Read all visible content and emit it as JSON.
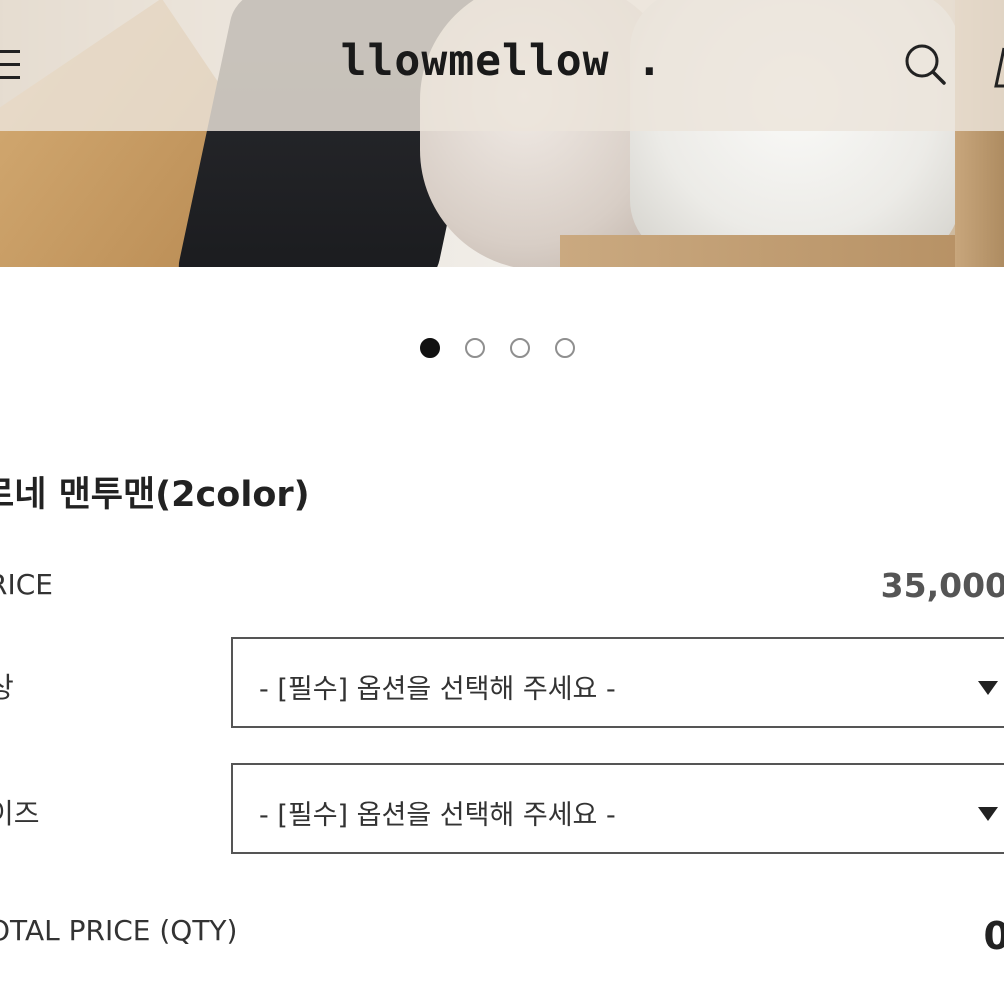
{
  "header": {
    "logo": "llowmellow ."
  },
  "icons": {
    "menu": "menu-icon",
    "search": "search-icon",
    "cart": "cart-icon"
  },
  "carousel": {
    "total_slides": 4,
    "active_index": 0
  },
  "product": {
    "title": "로네 맨투맨(2color)",
    "price_label": "RICE",
    "price_value": "35,000",
    "options": [
      {
        "label": "상",
        "placeholder": "- [필수] 옵션을 선택해 주세요 -"
      },
      {
        "label": "이즈",
        "placeholder": "- [필수] 옵션을 선택해 주세요 -"
      }
    ],
    "total_label": "OTAL PRICE (QTY)",
    "total_value": "0"
  }
}
